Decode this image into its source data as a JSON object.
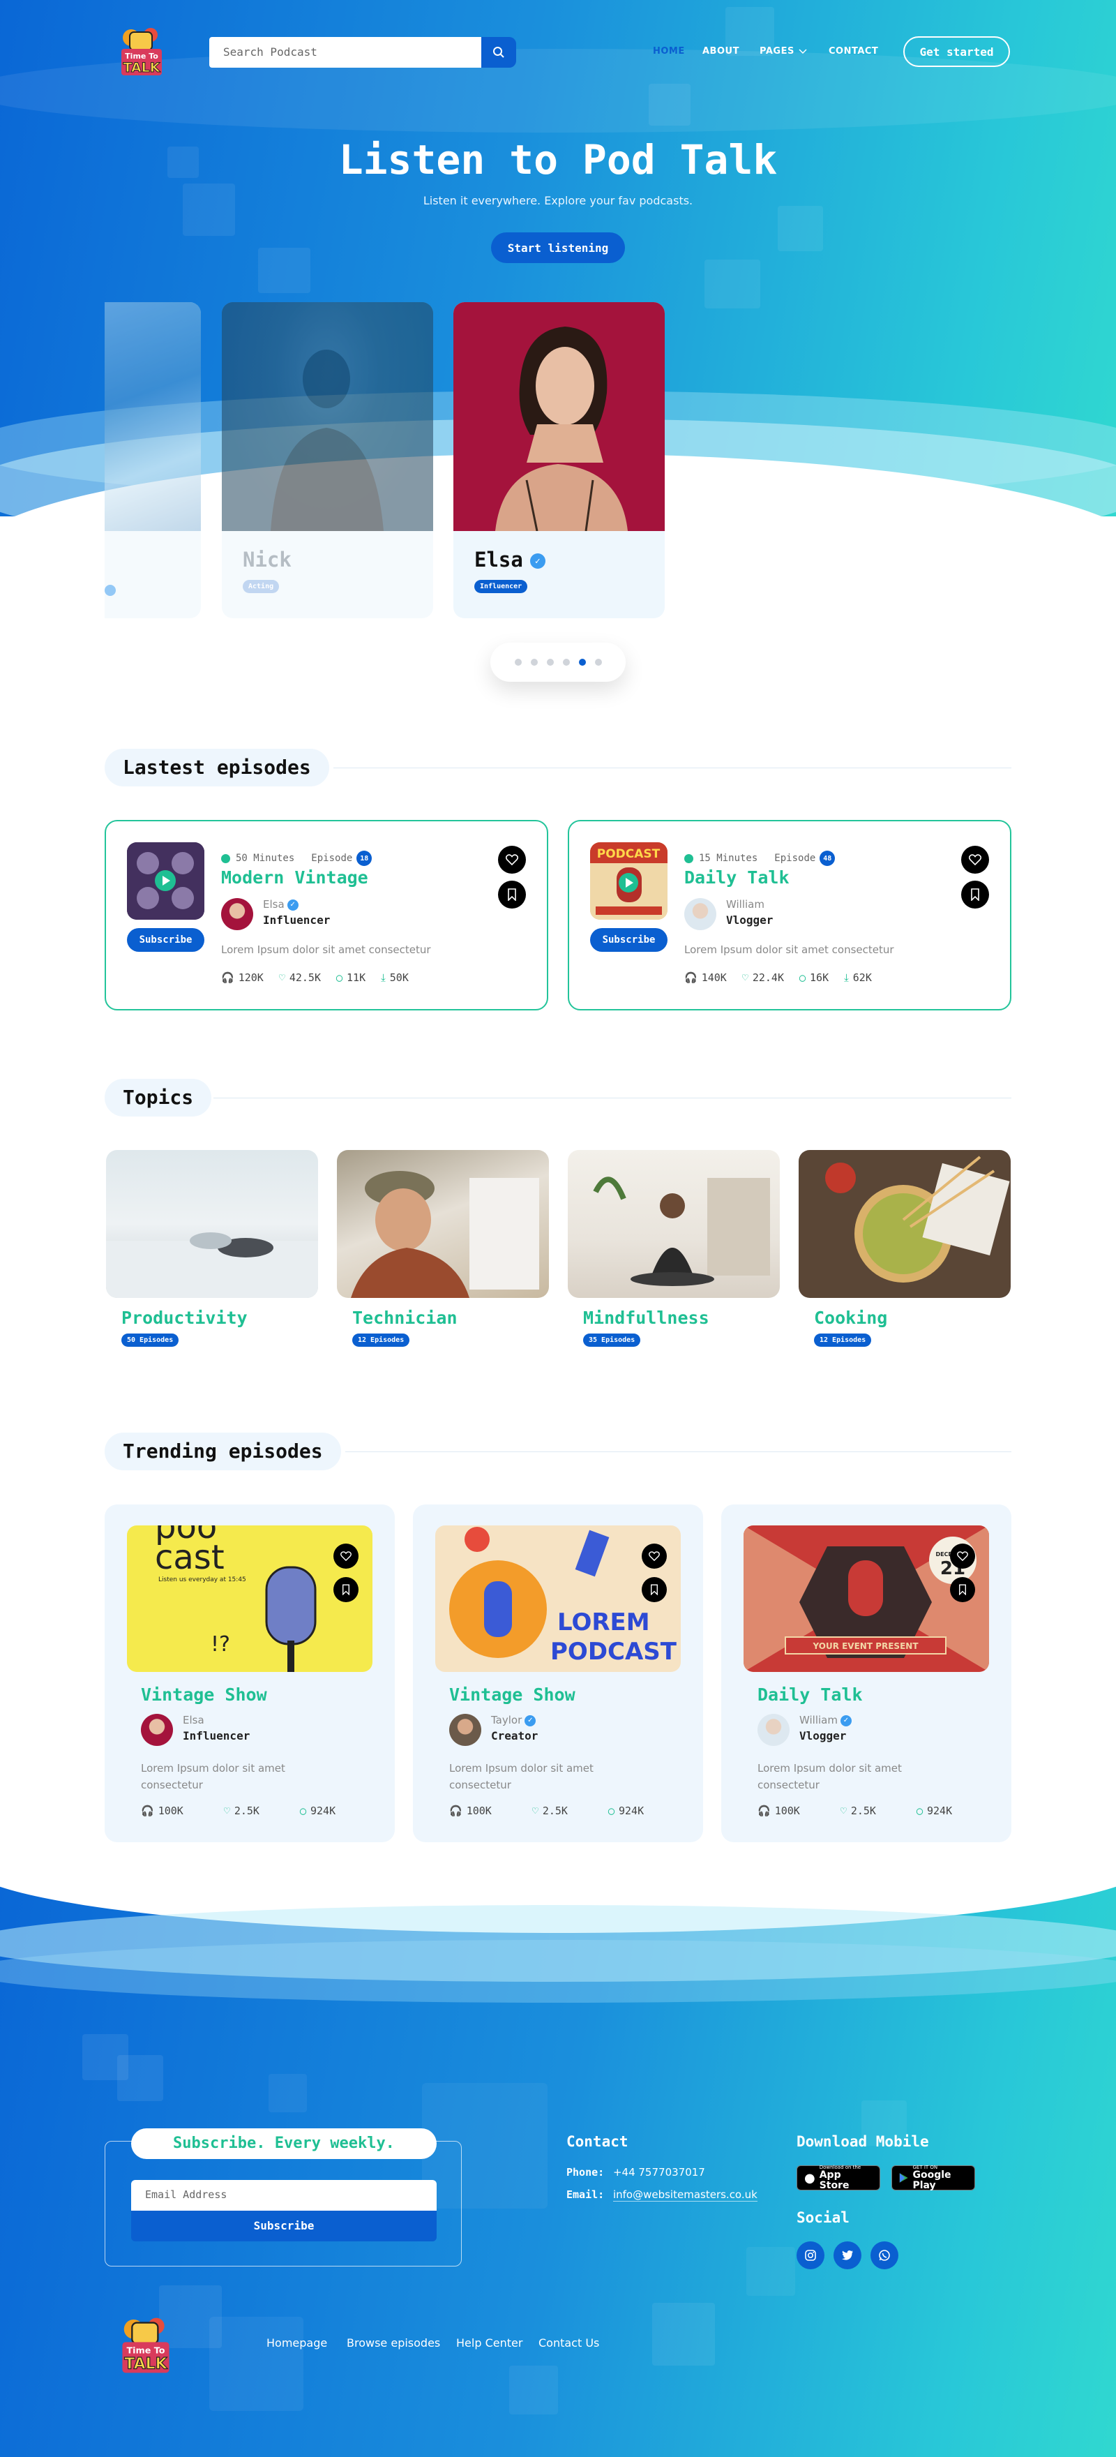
{
  "header": {
    "logo_text": [
      "Time To",
      "TALK"
    ],
    "search_placeholder": "Search Podcast",
    "nav": [
      "HOME",
      "ABOUT",
      "PAGES",
      "CONTACT"
    ],
    "cta": "Get started"
  },
  "hero": {
    "title": "Listen to Pod Talk",
    "subtitle": "Listen it everywhere. Explore your fav podcasts.",
    "button": "Start listening"
  },
  "hosts": [
    {
      "name": "Nick",
      "tag": "Acting"
    },
    {
      "name": "Elsa",
      "tag": "Influencer"
    }
  ],
  "carousel": {
    "total": 6,
    "active": 5
  },
  "latest": {
    "title": "Lastest episodes",
    "subscribe_label": "Subscribe",
    "episode_label": "Episode",
    "items": [
      {
        "duration": "50 Minutes",
        "episode": "18",
        "title": "Modern Vintage",
        "host": "Elsa",
        "role": "Influencer",
        "desc": "Lorem Ipsum dolor sit amet consectetur",
        "stats": [
          "120K",
          "42.5K",
          "11K",
          "50K"
        ]
      },
      {
        "duration": "15 Minutes",
        "episode": "48",
        "title": "Daily Talk",
        "host": "William",
        "role": "Vlogger",
        "desc": "Lorem Ipsum dolor sit amet consectetur",
        "stats": [
          "140K",
          "22.4K",
          "16K",
          "62K"
        ]
      }
    ]
  },
  "topics": {
    "title": "Topics",
    "items": [
      {
        "name": "Productivity",
        "badge": "50 Episodes"
      },
      {
        "name": "Technician",
        "badge": "12 Episodes"
      },
      {
        "name": "Mindfullness",
        "badge": "35 Episodes"
      },
      {
        "name": "Cooking",
        "badge": "12 Episodes"
      }
    ]
  },
  "trending": {
    "title": "Trending episodes",
    "items": [
      {
        "title": "Vintage Show",
        "host": "Elsa",
        "role": "Influencer",
        "desc": "Lorem Ipsum dolor sit amet consectetur",
        "stats": [
          "100K",
          "2.5K",
          "924K"
        ],
        "art": {
          "line1": "poo",
          "line2": "cast",
          "line3": "Listen us everyday at 15:45"
        }
      },
      {
        "title": "Vintage Show",
        "host": "Taylor",
        "role": "Creator",
        "desc": "Lorem Ipsum dolor sit amet consectetur",
        "stats": [
          "100K",
          "2.5K",
          "924K"
        ],
        "art": {
          "line1": "LOREM",
          "line2": "PODCAST"
        }
      },
      {
        "title": "Daily Talk",
        "host": "William",
        "role": "Vlogger",
        "desc": "Lorem Ipsum dolor sit amet consectetur",
        "stats": [
          "100K",
          "2.5K",
          "924K"
        ],
        "art": {
          "line1": "DECEMBER",
          "line2": "21",
          "line3": "YOUR EVENT PRESENT"
        }
      }
    ]
  },
  "footer": {
    "subscribe_heading": "Subscribe. Every weekly.",
    "email_placeholder": "Email Address",
    "subscribe_button": "Subscribe",
    "contact_heading": "Contact",
    "phone_label": "Phone:",
    "phone": "+44 7577037017",
    "email_label": "Email:",
    "email": "info@websitemasters.co.uk",
    "download_heading": "Download Mobile",
    "app_store": {
      "small": "Download on the",
      "big": "App Store"
    },
    "google_play": {
      "small": "GET IT ON",
      "big": "Google Play"
    },
    "social_heading": "Social",
    "social": [
      "instagram-icon",
      "twitter-icon",
      "whatsapp-icon"
    ],
    "links": [
      "Homepage",
      "Browse episodes",
      "Help Center",
      "Contact Us"
    ]
  },
  "colors": {
    "primary": "#0a5fd0",
    "accent": "#1fbf93",
    "light": "#eef6fd"
  }
}
